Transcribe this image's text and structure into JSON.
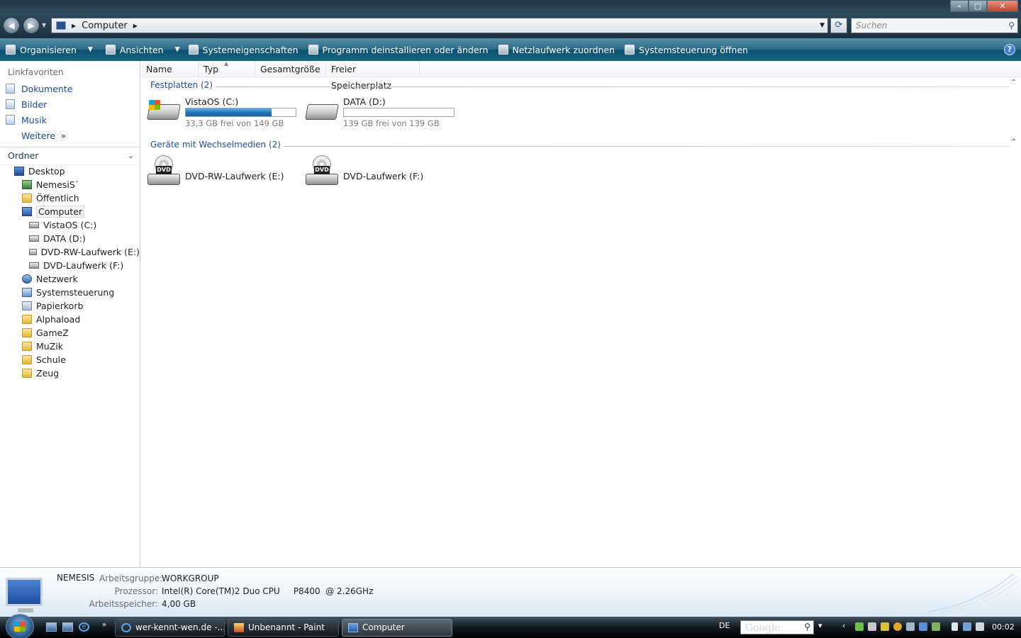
{
  "window": {
    "address": {
      "crumb": "Computer"
    },
    "search_placeholder": "Suchen",
    "controls": {
      "minimize": "–",
      "maximize": "▢",
      "close": "✕"
    }
  },
  "toolbar": {
    "items": [
      {
        "label": "Organisieren",
        "icon": "organize-icon"
      },
      {
        "label": "Ansichten",
        "icon": "views-icon"
      },
      {
        "label": "Systemeigenschaften",
        "icon": "system-properties-icon"
      },
      {
        "label": "Programm deinstallieren oder ändern",
        "icon": "uninstall-icon"
      },
      {
        "label": "Netzlaufwerk zuordnen",
        "icon": "network-drive-icon"
      },
      {
        "label": "Systemsteuerung öffnen",
        "icon": "control-panel-icon"
      }
    ],
    "help": "?"
  },
  "sidebar": {
    "favorites_header": "Linkfavoriten",
    "favorites": [
      "Dokumente",
      "Bilder",
      "Musik"
    ],
    "more": "Weitere",
    "folders_header": "Ordner",
    "tree": [
      {
        "label": "Desktop",
        "level": 0,
        "icon": "desktop-icon"
      },
      {
        "label": "NemesiS`",
        "level": 1,
        "icon": "user-folder-icon"
      },
      {
        "label": "Öffentlich",
        "level": 1,
        "icon": "folder-icon"
      },
      {
        "label": "Computer",
        "level": 1,
        "icon": "computer-icon",
        "selected": true
      },
      {
        "label": "VistaOS (C:)",
        "level": 2,
        "icon": "system-drive-icon"
      },
      {
        "label": "DATA (D:)",
        "level": 2,
        "icon": "drive-icon"
      },
      {
        "label": "DVD-RW-Laufwerk (E:)",
        "level": 2,
        "icon": "dvd-drive-icon"
      },
      {
        "label": "DVD-Laufwerk (F:)",
        "level": 2,
        "icon": "dvd-drive-icon"
      },
      {
        "label": "Netzwerk",
        "level": 1,
        "icon": "network-icon"
      },
      {
        "label": "Systemsteuerung",
        "level": 1,
        "icon": "control-panel-icon"
      },
      {
        "label": "Papierkorb",
        "level": 1,
        "icon": "recycle-bin-icon"
      },
      {
        "label": "Alphaload",
        "level": 1,
        "icon": "folder-icon"
      },
      {
        "label": "GameZ",
        "level": 1,
        "icon": "folder-icon"
      },
      {
        "label": "MuZik",
        "level": 1,
        "icon": "folder-icon"
      },
      {
        "label": "Schule",
        "level": 1,
        "icon": "folder-icon"
      },
      {
        "label": "Zeug",
        "level": 1,
        "icon": "folder-icon"
      }
    ]
  },
  "main": {
    "columns": [
      "Name",
      "Typ",
      "Gesamtgröße",
      "Freier Speicherplatz"
    ],
    "groups": [
      {
        "title": "Festplatten (2)",
        "items": [
          {
            "name": "VistaOS (C:)",
            "free_text": "33,3 GB frei von 149 GB",
            "used_fraction": 0.78
          },
          {
            "name": "DATA (D:)",
            "free_text": "139 GB frei von 139 GB",
            "used_fraction": 0.0
          }
        ]
      },
      {
        "title": "Geräte mit Wechselmedien (2)",
        "items": [
          {
            "name": "DVD-RW-Laufwerk (E:)",
            "badge": "DVD"
          },
          {
            "name": "DVD-Laufwerk (F:)",
            "badge": "DVD"
          }
        ]
      }
    ]
  },
  "details": {
    "computer_name": "NEMESIS",
    "workgroup_label": "Arbeitsgruppe:",
    "workgroup": "WORKGROUP",
    "cpu_label": "Prozessor:",
    "cpu": "Intel(R) Core(TM)2 Duo CPU     P8400  @ 2.26GHz",
    "ram_label": "Arbeitsspeicher:",
    "ram": "4,00 GB"
  },
  "taskbar": {
    "more": "»",
    "tasks": [
      {
        "label": "wer-kennt-wen.de -...",
        "icon": "internet-explorer-icon"
      },
      {
        "label": "Unbenannt - Paint",
        "icon": "paint-icon"
      },
      {
        "label": "Computer",
        "icon": "computer-icon",
        "active": true
      }
    ],
    "language": "DE",
    "search_logo": "Google",
    "clock": "00:02"
  }
}
